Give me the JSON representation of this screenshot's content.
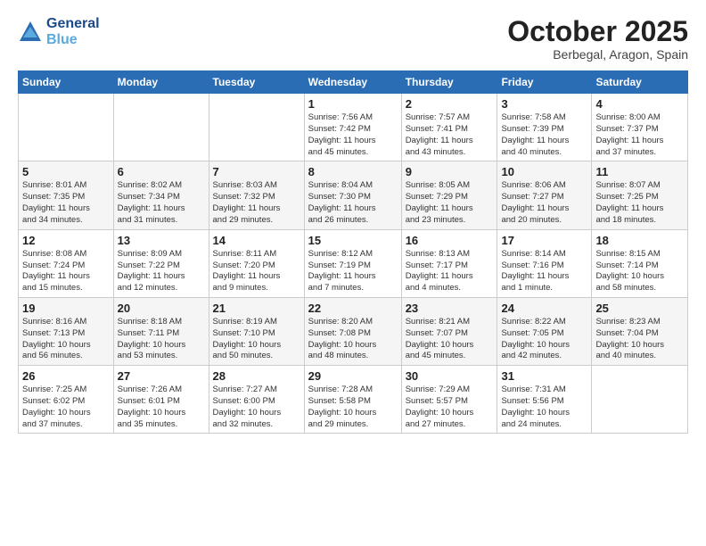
{
  "header": {
    "logo_line1": "General",
    "logo_line2": "Blue",
    "month": "October 2025",
    "location": "Berbegal, Aragon, Spain"
  },
  "weekdays": [
    "Sunday",
    "Monday",
    "Tuesday",
    "Wednesday",
    "Thursday",
    "Friday",
    "Saturday"
  ],
  "weeks": [
    [
      {
        "day": "",
        "info": ""
      },
      {
        "day": "",
        "info": ""
      },
      {
        "day": "",
        "info": ""
      },
      {
        "day": "1",
        "info": "Sunrise: 7:56 AM\nSunset: 7:42 PM\nDaylight: 11 hours\nand 45 minutes."
      },
      {
        "day": "2",
        "info": "Sunrise: 7:57 AM\nSunset: 7:41 PM\nDaylight: 11 hours\nand 43 minutes."
      },
      {
        "day": "3",
        "info": "Sunrise: 7:58 AM\nSunset: 7:39 PM\nDaylight: 11 hours\nand 40 minutes."
      },
      {
        "day": "4",
        "info": "Sunrise: 8:00 AM\nSunset: 7:37 PM\nDaylight: 11 hours\nand 37 minutes."
      }
    ],
    [
      {
        "day": "5",
        "info": "Sunrise: 8:01 AM\nSunset: 7:35 PM\nDaylight: 11 hours\nand 34 minutes."
      },
      {
        "day": "6",
        "info": "Sunrise: 8:02 AM\nSunset: 7:34 PM\nDaylight: 11 hours\nand 31 minutes."
      },
      {
        "day": "7",
        "info": "Sunrise: 8:03 AM\nSunset: 7:32 PM\nDaylight: 11 hours\nand 29 minutes."
      },
      {
        "day": "8",
        "info": "Sunrise: 8:04 AM\nSunset: 7:30 PM\nDaylight: 11 hours\nand 26 minutes."
      },
      {
        "day": "9",
        "info": "Sunrise: 8:05 AM\nSunset: 7:29 PM\nDaylight: 11 hours\nand 23 minutes."
      },
      {
        "day": "10",
        "info": "Sunrise: 8:06 AM\nSunset: 7:27 PM\nDaylight: 11 hours\nand 20 minutes."
      },
      {
        "day": "11",
        "info": "Sunrise: 8:07 AM\nSunset: 7:25 PM\nDaylight: 11 hours\nand 18 minutes."
      }
    ],
    [
      {
        "day": "12",
        "info": "Sunrise: 8:08 AM\nSunset: 7:24 PM\nDaylight: 11 hours\nand 15 minutes."
      },
      {
        "day": "13",
        "info": "Sunrise: 8:09 AM\nSunset: 7:22 PM\nDaylight: 11 hours\nand 12 minutes."
      },
      {
        "day": "14",
        "info": "Sunrise: 8:11 AM\nSunset: 7:20 PM\nDaylight: 11 hours\nand 9 minutes."
      },
      {
        "day": "15",
        "info": "Sunrise: 8:12 AM\nSunset: 7:19 PM\nDaylight: 11 hours\nand 7 minutes."
      },
      {
        "day": "16",
        "info": "Sunrise: 8:13 AM\nSunset: 7:17 PM\nDaylight: 11 hours\nand 4 minutes."
      },
      {
        "day": "17",
        "info": "Sunrise: 8:14 AM\nSunset: 7:16 PM\nDaylight: 11 hours\nand 1 minute."
      },
      {
        "day": "18",
        "info": "Sunrise: 8:15 AM\nSunset: 7:14 PM\nDaylight: 10 hours\nand 58 minutes."
      }
    ],
    [
      {
        "day": "19",
        "info": "Sunrise: 8:16 AM\nSunset: 7:13 PM\nDaylight: 10 hours\nand 56 minutes."
      },
      {
        "day": "20",
        "info": "Sunrise: 8:18 AM\nSunset: 7:11 PM\nDaylight: 10 hours\nand 53 minutes."
      },
      {
        "day": "21",
        "info": "Sunrise: 8:19 AM\nSunset: 7:10 PM\nDaylight: 10 hours\nand 50 minutes."
      },
      {
        "day": "22",
        "info": "Sunrise: 8:20 AM\nSunset: 7:08 PM\nDaylight: 10 hours\nand 48 minutes."
      },
      {
        "day": "23",
        "info": "Sunrise: 8:21 AM\nSunset: 7:07 PM\nDaylight: 10 hours\nand 45 minutes."
      },
      {
        "day": "24",
        "info": "Sunrise: 8:22 AM\nSunset: 7:05 PM\nDaylight: 10 hours\nand 42 minutes."
      },
      {
        "day": "25",
        "info": "Sunrise: 8:23 AM\nSunset: 7:04 PM\nDaylight: 10 hours\nand 40 minutes."
      }
    ],
    [
      {
        "day": "26",
        "info": "Sunrise: 7:25 AM\nSunset: 6:02 PM\nDaylight: 10 hours\nand 37 minutes."
      },
      {
        "day": "27",
        "info": "Sunrise: 7:26 AM\nSunset: 6:01 PM\nDaylight: 10 hours\nand 35 minutes."
      },
      {
        "day": "28",
        "info": "Sunrise: 7:27 AM\nSunset: 6:00 PM\nDaylight: 10 hours\nand 32 minutes."
      },
      {
        "day": "29",
        "info": "Sunrise: 7:28 AM\nSunset: 5:58 PM\nDaylight: 10 hours\nand 29 minutes."
      },
      {
        "day": "30",
        "info": "Sunrise: 7:29 AM\nSunset: 5:57 PM\nDaylight: 10 hours\nand 27 minutes."
      },
      {
        "day": "31",
        "info": "Sunrise: 7:31 AM\nSunset: 5:56 PM\nDaylight: 10 hours\nand 24 minutes."
      },
      {
        "day": "",
        "info": ""
      }
    ]
  ]
}
